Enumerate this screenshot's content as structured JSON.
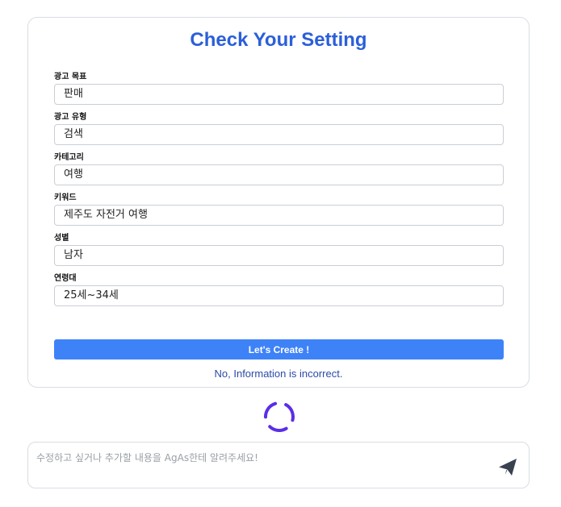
{
  "card": {
    "title": "Check Your Setting",
    "fields": [
      {
        "label": "광고 목표",
        "value": "판매"
      },
      {
        "label": "광고 유형",
        "value": "검색"
      },
      {
        "label": "카테고리",
        "value": "여행"
      },
      {
        "label": "키워드",
        "value": "제주도 자전거 여행"
      },
      {
        "label": "성별",
        "value": "남자"
      },
      {
        "label": "연령대",
        "value": "25세~34세"
      }
    ],
    "create_button": "Let's Create !",
    "incorrect_link": "No, Information is incorrect."
  },
  "loading": {
    "icon": "loading-spinner-icon",
    "color": "#5b2ee6"
  },
  "chat": {
    "placeholder": "수정하고 싶거나 추가할 내용을 AgAs한테 알려주세요!",
    "value": "",
    "send_icon": "send-paper-plane-icon"
  },
  "colors": {
    "title": "#2b5fd9",
    "button": "#3e82f7",
    "link": "#2b4aa8",
    "send_icon": "#3a4250"
  }
}
